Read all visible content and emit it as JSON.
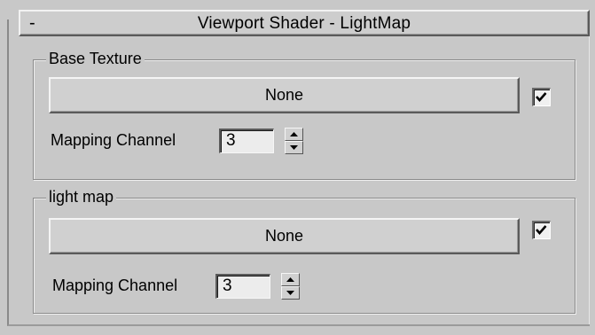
{
  "rollout": {
    "title": "Viewport Shader - LightMap",
    "collapse_glyph": "-"
  },
  "base_texture": {
    "legend": "Base Texture",
    "map_button_label": "None",
    "enabled_checked": true,
    "mapping_channel_label": "Mapping Channel",
    "mapping_channel_value": "3"
  },
  "light_map": {
    "legend": "light map",
    "map_button_label": "None",
    "enabled_checked": true,
    "mapping_channel_label": "Mapping Channel",
    "mapping_channel_value": "3"
  },
  "icons": {
    "collapse": "minus-icon",
    "check": "checkmark-icon",
    "spinner_up": "arrow-up-icon",
    "spinner_down": "arrow-down-icon"
  },
  "colors": {
    "panel_background": "#c8c8c8",
    "button_face": "#d0d0d0",
    "field_background": "#ececec"
  }
}
